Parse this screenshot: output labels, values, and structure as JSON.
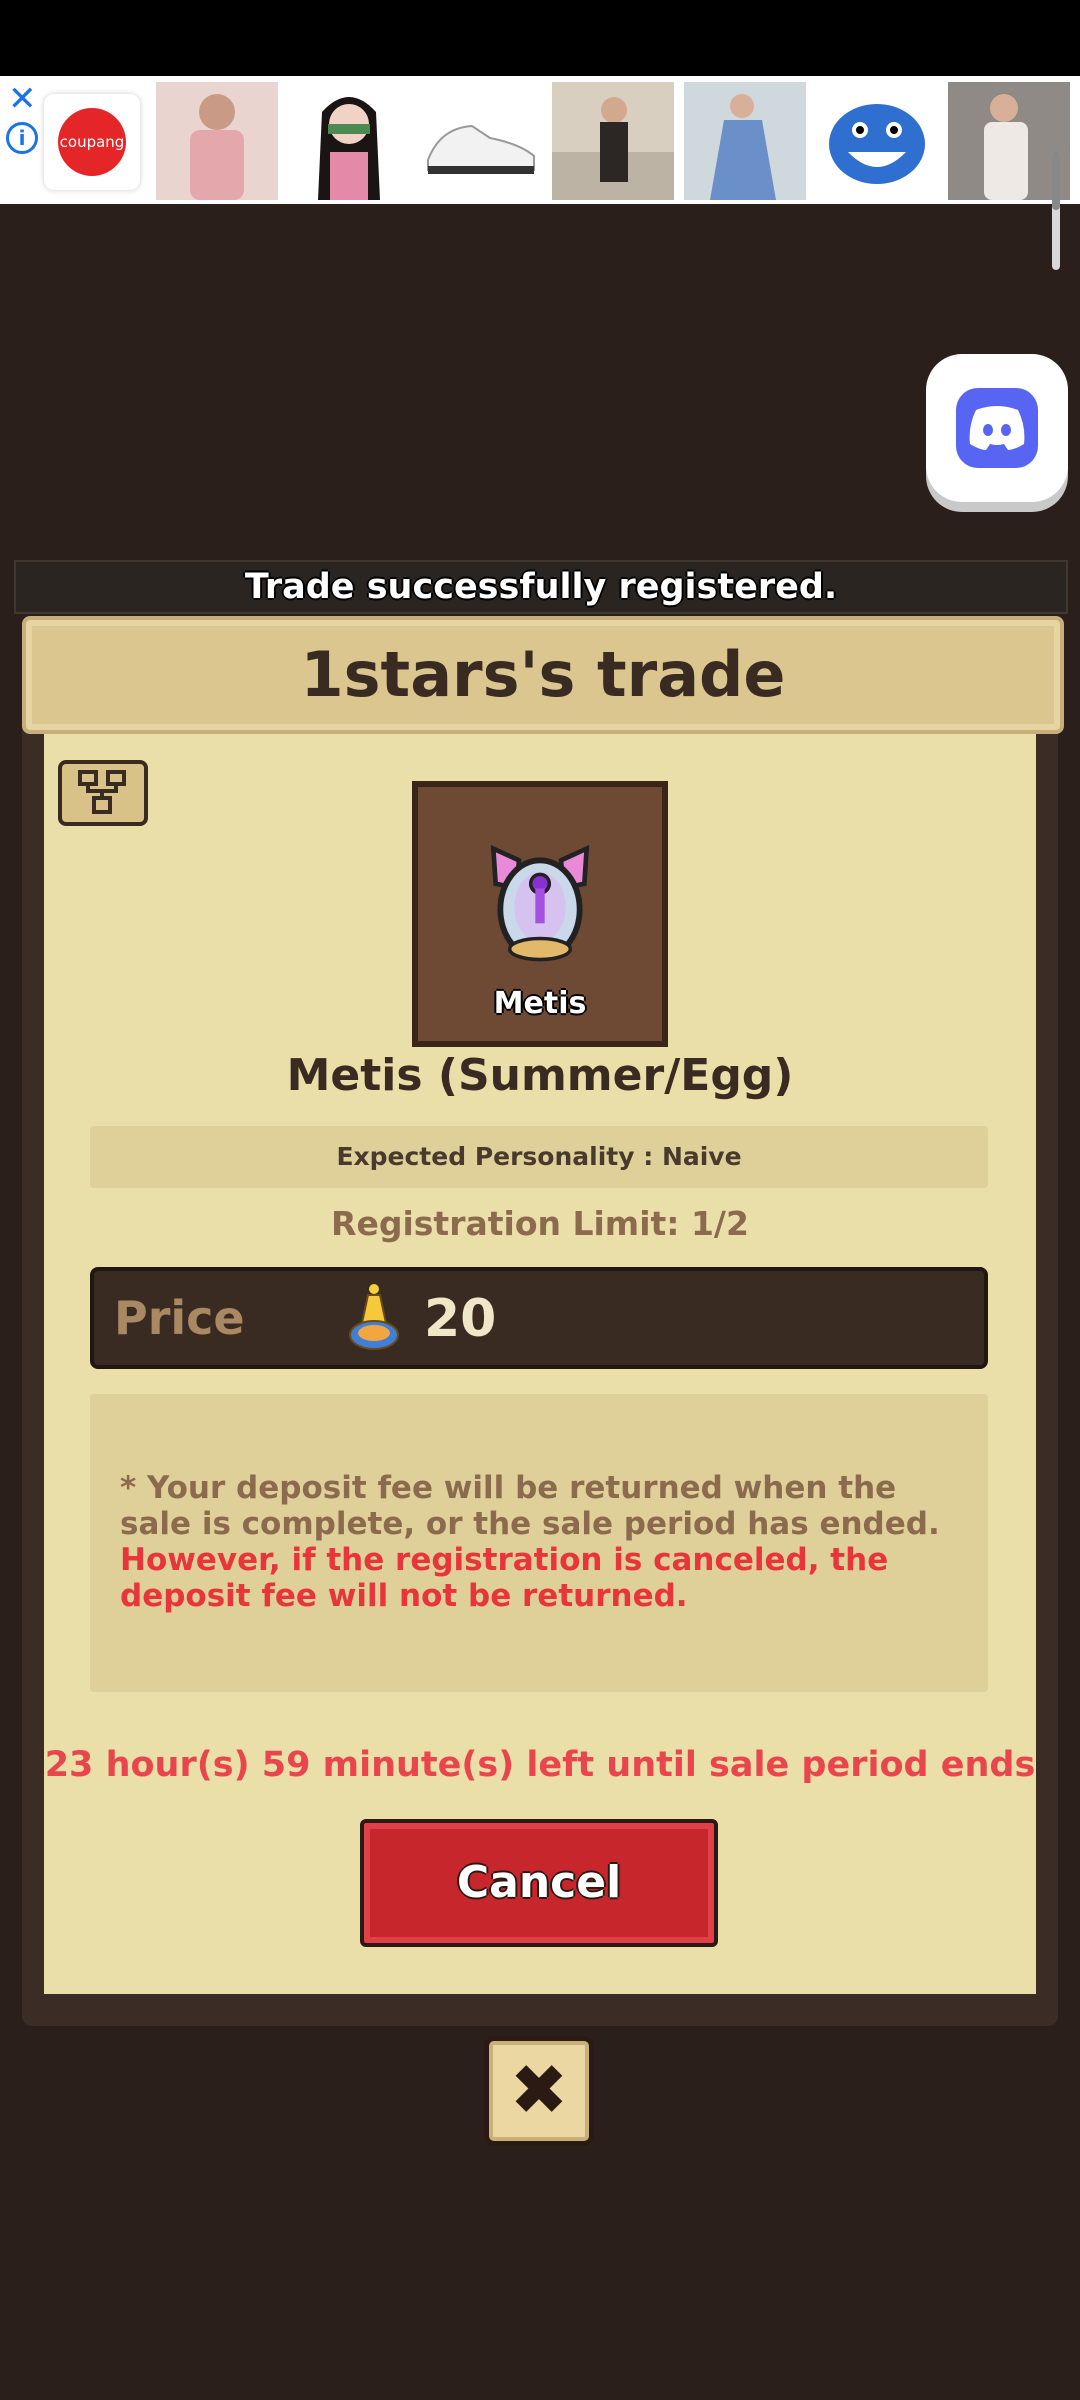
{
  "ad": {
    "close_icon": "close-icon",
    "info_icon": "info-icon",
    "brand": "coupang"
  },
  "toast": {
    "message": "Trade successfully registered."
  },
  "panel": {
    "title": "1stars's trade",
    "item": {
      "label": "Metis",
      "name": "Metis (Summer/Egg)",
      "personality": "Expected Personality : Naive",
      "registration_limit": "Registration Limit: 1/2"
    },
    "price": {
      "label": "Price",
      "value": "20"
    },
    "notice": {
      "normal": "* Your deposit fee will be returned when the sale is complete, or the sale period has ended. ",
      "warning": "However, if the registration is canceled, the deposit fee will not be returned."
    },
    "time_left": "23 hour(s) 59 minute(s) left until sale period ends",
    "cancel_label": "Cancel",
    "close_label": "✖"
  },
  "colors": {
    "background": "#2a1f1a",
    "panel": "#eadfa8",
    "accent_red": "#c8262d",
    "discord": "#5865f2"
  }
}
